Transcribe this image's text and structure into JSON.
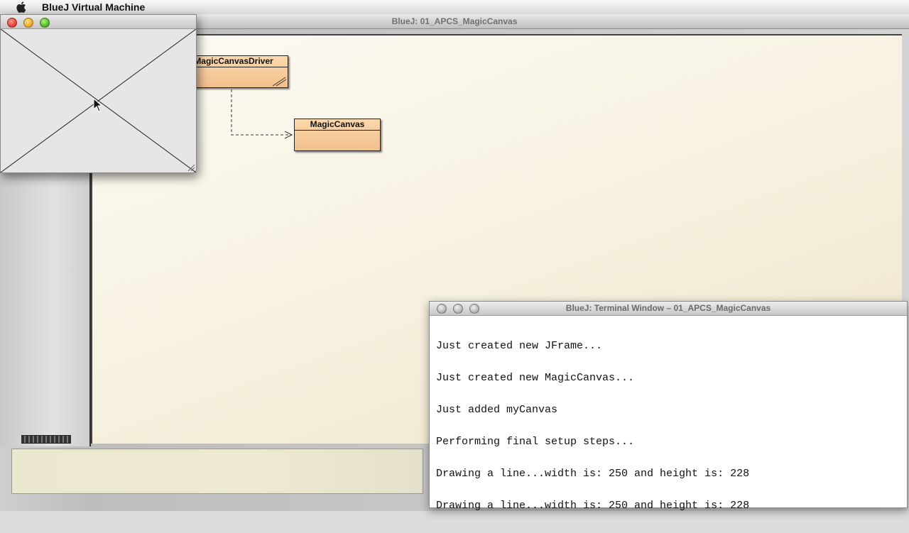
{
  "menubar": {
    "app_name": "BlueJ Virtual Machine"
  },
  "main_window": {
    "title": "BlueJ:  01_APCS_MagicCanvas"
  },
  "diagram": {
    "classes": [
      {
        "name": "MagicCanvasDriver"
      },
      {
        "name": "MagicCanvas"
      }
    ],
    "colors": {
      "class_fill": "#f3c08d",
      "canvas_bg": "#f6f0de"
    }
  },
  "terminal": {
    "title": "BlueJ: Terminal Window – 01_APCS_MagicCanvas",
    "lines": [
      "Just created new JFrame...",
      "Just created new MagicCanvas...",
      "Just added myCanvas",
      "Performing final setup steps...",
      "Drawing a line...width is: 250 and height is: 228",
      "Drawing a line...width is: 250 and height is: 228"
    ]
  },
  "icons": {
    "apple": "apple-icon",
    "close": "close-button",
    "minimize": "minimize-button",
    "zoom": "zoom-button",
    "resize": "resize-grip-icon",
    "cursor": "mouse-cursor-icon"
  }
}
